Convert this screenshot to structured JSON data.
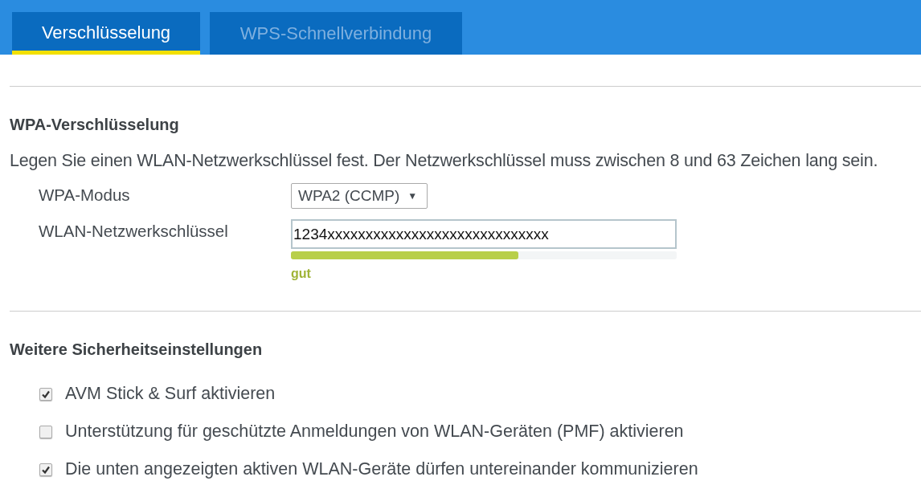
{
  "tabs": [
    {
      "label": "Verschlüsselung",
      "selected": true
    },
    {
      "label": "WPS-Schnellverbindung",
      "selected": false
    }
  ],
  "wpa_section": {
    "heading": "WPA-Verschlüsselung",
    "description": "Legen Sie einen WLAN-Netzwerkschlüssel fest. Der Netzwerkschlüssel muss zwischen 8 und 63 Zeichen lang sein.",
    "fields": [
      {
        "kind": "select",
        "label": "WPA-Modus",
        "value": "WPA2 (CCMP)",
        "arrow": "▼"
      },
      {
        "kind": "password",
        "label": "WLAN-Netzwerkschlüssel",
        "value": "1234xxxxxxxxxxxxxxxxxxxxxxxxxxxxx",
        "strength": {
          "level": 0.59,
          "label": "gut",
          "color": "#b8cf4a"
        }
      }
    ]
  },
  "security_section": {
    "heading": "Weitere Sicherheitseinstellungen",
    "options": [
      {
        "label": "AVM Stick & Surf aktivieren",
        "checked": true
      },
      {
        "label": "Unterstützung für geschützte Anmeldungen von WLAN-Geräten (PMF) aktivieren",
        "checked": false
      },
      {
        "label": "Die unten angezeigten aktiven WLAN-Geräte dürfen untereinander kommunizieren",
        "checked": true
      }
    ]
  }
}
